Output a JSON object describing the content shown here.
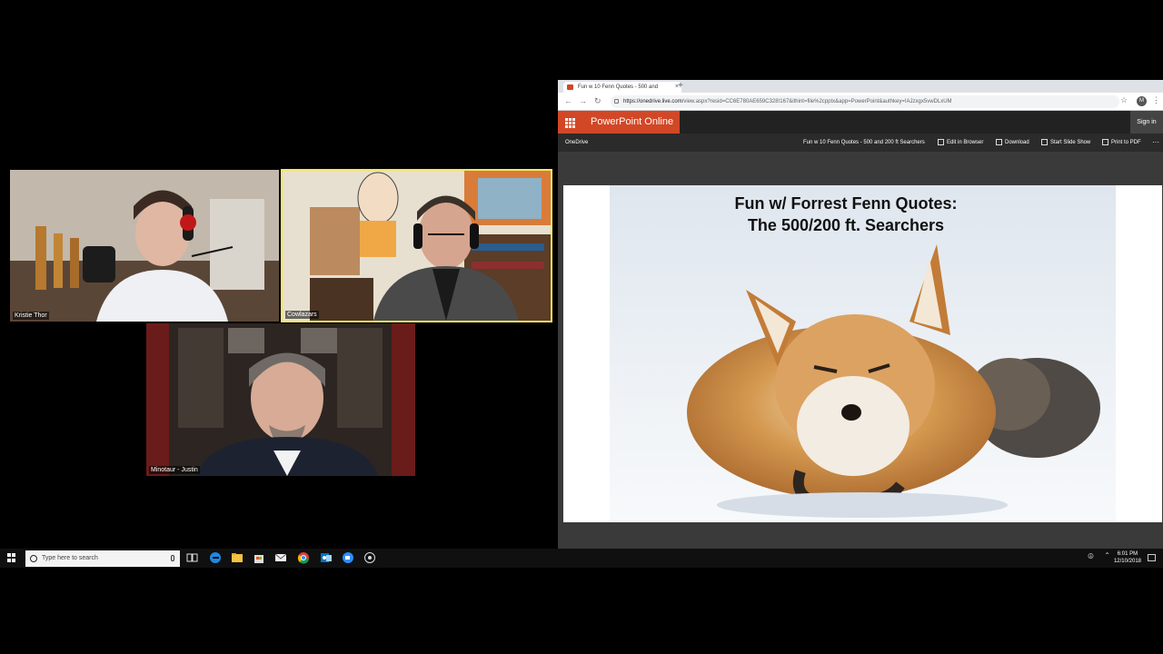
{
  "zoom": {
    "participants": [
      {
        "name": "Kristie Thor"
      },
      {
        "name": "Cowlazars"
      },
      {
        "name": "Minotaur - Justin"
      }
    ]
  },
  "browser": {
    "tab_title": "Fun w 10 Fenn Quotes - 500 and",
    "new_tab": "+",
    "close_tab": "×",
    "url_host": "https://onedrive.live.com",
    "url_path": "/view.aspx?resid=CC6E780AE659C328!167&ithint=file%2cpptx&app=PowerPoint&authkey=!AJzxgx5vwDLxUM",
    "profile_initial": "M"
  },
  "powerpoint": {
    "app_name": "PowerPoint Online",
    "sign_in": "Sign in",
    "onedrive": "OneDrive",
    "document_title": "Fun w 10 Fenn Quotes - 500 and 200 ft Searchers",
    "commands": {
      "edit": "Edit in Browser",
      "download": "Download",
      "slideshow": "Start Slide Show",
      "print": "Print to PDF",
      "more": "···"
    },
    "slide_title": "Fun w/ Forrest Fenn Quotes:\nThe 500/200 ft. Searchers"
  },
  "taskbar": {
    "search_placeholder": "Type here to search",
    "time": "6:01 PM",
    "date": "12/10/2018"
  },
  "colors": {
    "accent_powerpoint": "#d24726",
    "active_speaker": "#f5e663"
  }
}
